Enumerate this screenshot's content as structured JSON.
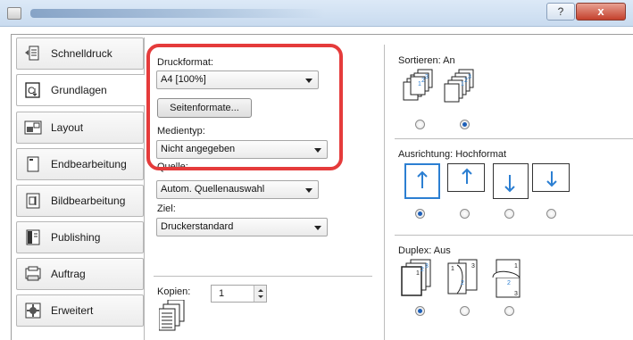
{
  "window": {
    "help_label": "?",
    "close_label": "x"
  },
  "sidebar": {
    "items": [
      {
        "label": "Schnelldruck",
        "icon": "quick-print-icon"
      },
      {
        "label": "Grundlagen",
        "icon": "basic-icon",
        "active": true
      },
      {
        "label": "Layout",
        "icon": "layout-icon"
      },
      {
        "label": "Endbearbeitung",
        "icon": "finishing-icon"
      },
      {
        "label": "Bildbearbeitung",
        "icon": "imaging-icon"
      },
      {
        "label": "Publishing",
        "icon": "publishing-icon"
      },
      {
        "label": "Auftrag",
        "icon": "job-icon"
      },
      {
        "label": "Erweitert",
        "icon": "advanced-icon"
      }
    ]
  },
  "main": {
    "druckformat_label": "Druckformat:",
    "druckformat_value": "A4  [100%]",
    "seitenformate_button": "Seitenformate...",
    "medientyp_label": "Medientyp:",
    "medientyp_value": "Nicht angegeben",
    "quelle_label": "Quelle:",
    "quelle_value": "Autom. Quellenauswahl",
    "ziel_label": "Ziel:",
    "ziel_value": "Druckerstandard",
    "kopien_label": "Kopien:",
    "kopien_value": "1"
  },
  "right": {
    "sortieren_label": "Sortieren:  An",
    "ausrichtung_label": "Ausrichtung:  Hochformat",
    "duplex_label": "Duplex:  Aus",
    "collate_pages_a": [
      "3",
      "2",
      "1",
      "3",
      "2",
      "1"
    ],
    "collate_pages_b": [
      "3",
      "2",
      "1",
      "3",
      "2",
      "1"
    ],
    "duplex_pages": [
      "2",
      "3",
      "1",
      "1",
      "3",
      "2",
      "1",
      "2",
      "3"
    ]
  },
  "colors": {
    "highlight": "#e53b3b",
    "accent": "#2c7fd2",
    "radio_selected": "#1d5fb8"
  }
}
